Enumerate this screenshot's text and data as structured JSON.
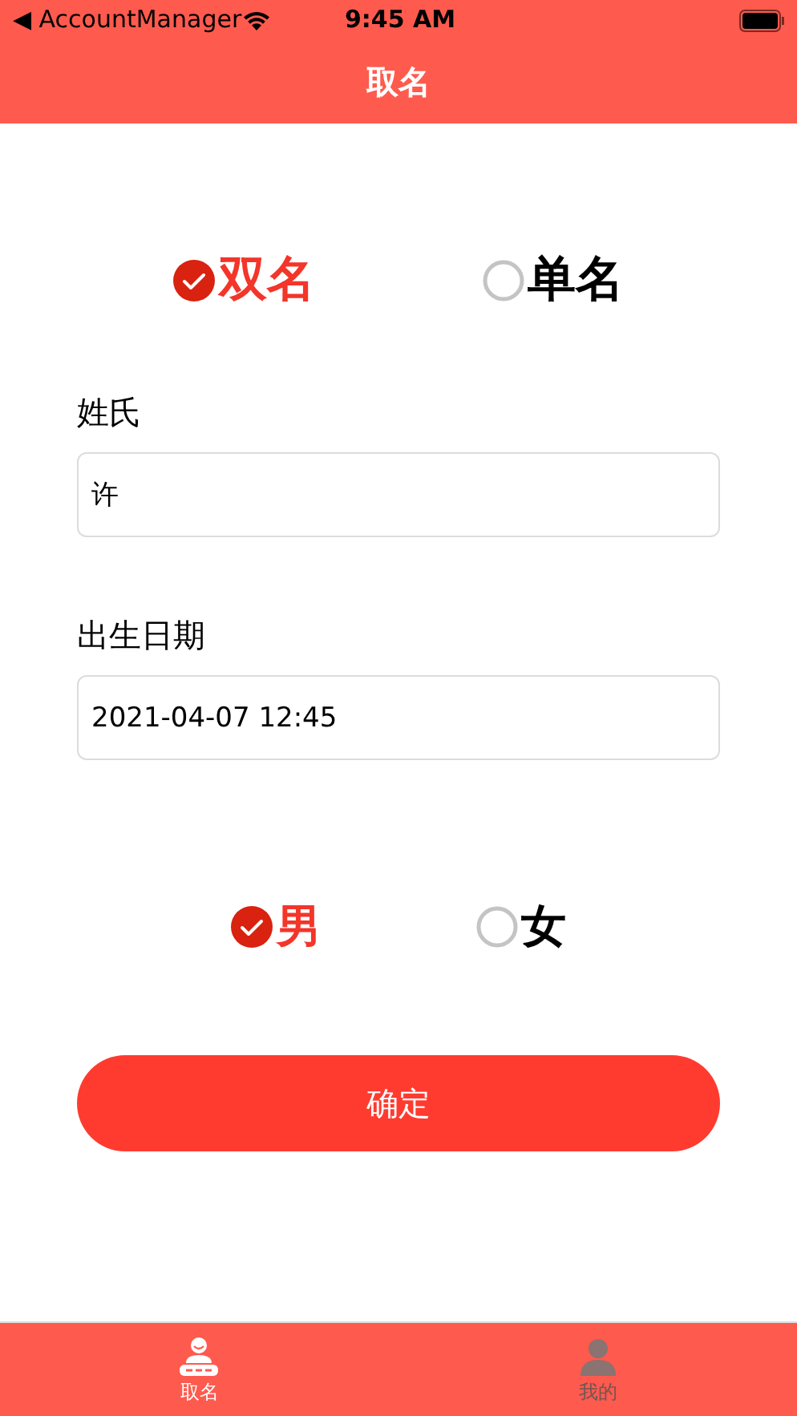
{
  "status_bar": {
    "back_app": "◀ AccountManager",
    "time": "9:45 AM"
  },
  "nav_bar": {
    "title": "取名"
  },
  "name_type": [
    {
      "label": "双名",
      "selected": true
    },
    {
      "label": "单名",
      "selected": false
    }
  ],
  "fields": [
    {
      "label": "姓氏",
      "value": "许"
    },
    {
      "label": "出生日期",
      "value": "2021-04-07 12:45"
    }
  ],
  "gender": [
    {
      "label": "男",
      "selected": true
    },
    {
      "label": "女",
      "selected": false
    }
  ],
  "confirm_button": "确定",
  "tab_bar": [
    {
      "label": "取名",
      "selected": true,
      "kind": "naming"
    },
    {
      "label": "我的",
      "selected": false,
      "kind": "person"
    }
  ]
}
